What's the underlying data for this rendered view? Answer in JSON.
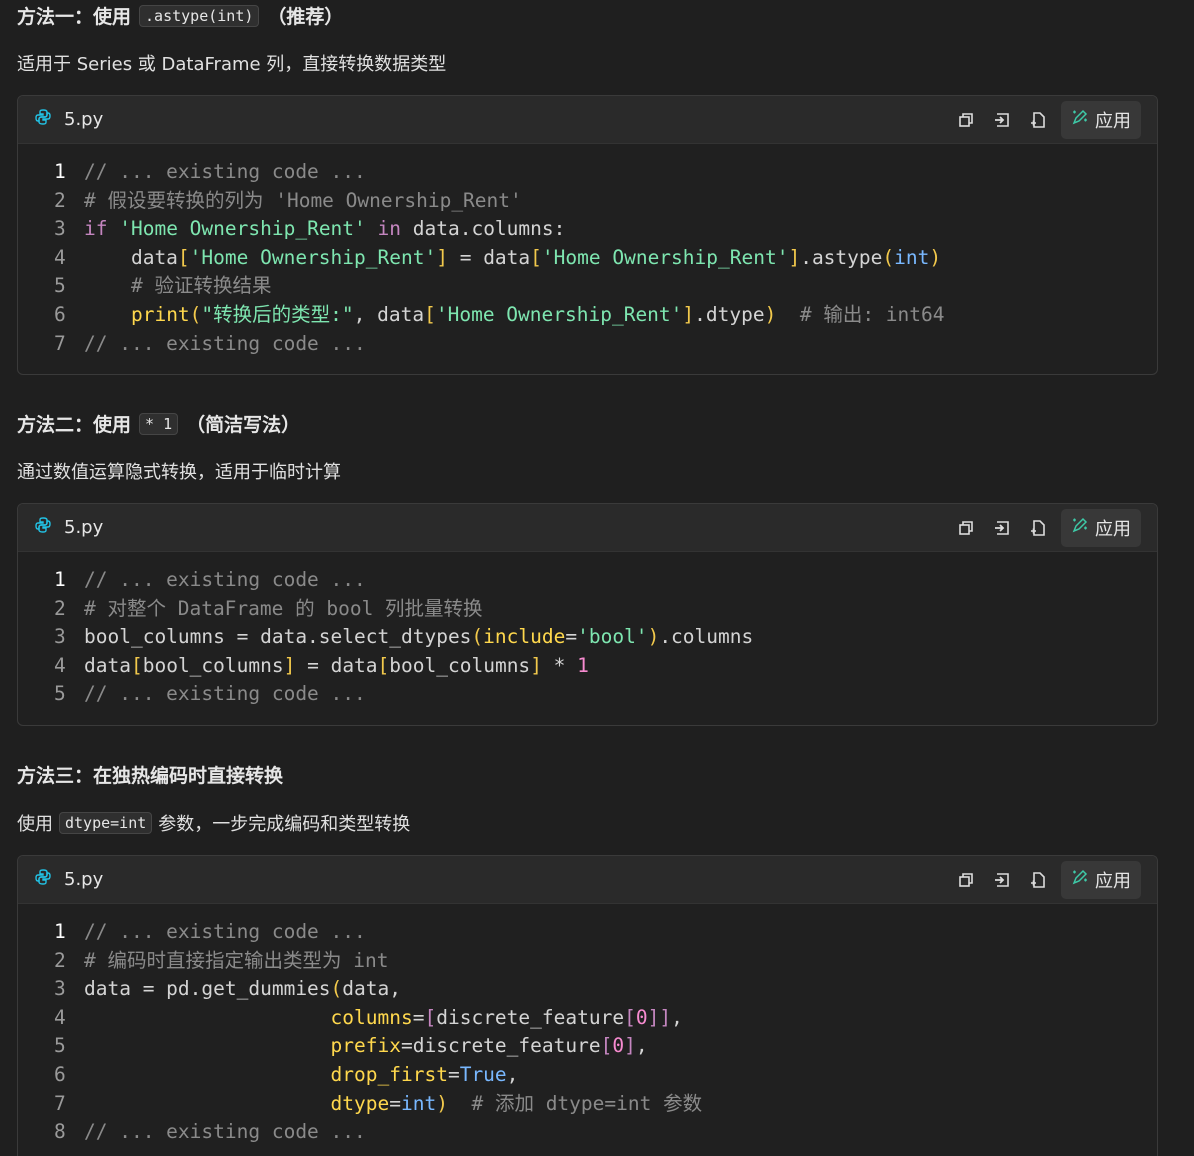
{
  "sections": [
    {
      "title_a": "方法一：使用",
      "title_code": ".astype(int)",
      "title_b": "（推荐）",
      "desc": "适用于 Series 或 DataFrame 列，直接转换数据类型"
    },
    {
      "title_a": "方法二：使用",
      "title_code": "* 1",
      "title_b": "（简洁写法）",
      "desc": "通过数值运算隐式转换，适用于临时计算"
    },
    {
      "title_a": "方法三：在独热编码时直接转换",
      "desc_a": "使用",
      "desc_code": "dtype=int",
      "desc_b": "参数，一步完成编码和类型转换"
    }
  ],
  "blocks": [
    {
      "filename": "5.py",
      "apply_label": "应用",
      "lines": [
        {
          "n": "1",
          "parts": [
            "// ... existing code ..."
          ]
        },
        {
          "n": "2",
          "parts": [
            "# 假设要转换的列为 'Home Ownership_Rent'"
          ]
        },
        {
          "n": "3",
          "parts": [
            "if",
            " ",
            "'Home Ownership_Rent'",
            " ",
            "in",
            " data.columns:"
          ]
        },
        {
          "n": "4",
          "parts": [
            "    data",
            "[",
            "'Home Ownership_Rent'",
            "]",
            " = data",
            "[",
            "'Home Ownership_Rent'",
            "]",
            ".astype",
            "(",
            "int",
            ")"
          ]
        },
        {
          "n": "5",
          "parts": [
            "    # 验证转换结果"
          ]
        },
        {
          "n": "6",
          "parts": [
            "    ",
            "print",
            "(",
            "\"转换后的类型:\"",
            ", data",
            "[",
            "'Home Ownership_Rent'",
            "]",
            ".dtype",
            ")",
            "  ",
            "# 输出: int64"
          ]
        },
        {
          "n": "7",
          "parts": [
            "// ... existing code ..."
          ]
        }
      ]
    },
    {
      "filename": "5.py",
      "apply_label": "应用",
      "lines": [
        {
          "n": "1",
          "parts": [
            "// ... existing code ..."
          ]
        },
        {
          "n": "2",
          "parts": [
            "# 对整个 DataFrame 的 bool 列批量转换"
          ]
        },
        {
          "n": "3",
          "parts": [
            "bool_columns = data.select_dtypes",
            "(",
            "include",
            "=",
            "'bool'",
            ")",
            ".columns"
          ]
        },
        {
          "n": "4",
          "parts": [
            "data",
            "[",
            "bool_columns",
            "]",
            " = data",
            "[",
            "bool_columns",
            "]",
            " * ",
            "1"
          ]
        },
        {
          "n": "5",
          "parts": [
            "// ... existing code ..."
          ]
        }
      ]
    },
    {
      "filename": "5.py",
      "apply_label": "应用",
      "lines": [
        {
          "n": "1",
          "parts": [
            "// ... existing code ..."
          ]
        },
        {
          "n": "2",
          "parts": [
            "# 编码时直接指定输出类型为 int"
          ]
        },
        {
          "n": "3",
          "parts": [
            "data = pd.get_dummies",
            "(",
            "data,"
          ]
        },
        {
          "n": "4",
          "parts": [
            "                     ",
            "columns",
            "=",
            "[",
            "discrete_feature",
            "[",
            "0",
            "]",
            "]",
            ","
          ]
        },
        {
          "n": "5",
          "parts": [
            "                     ",
            "prefix",
            "=discrete_feature",
            "[",
            "0",
            "]",
            ","
          ]
        },
        {
          "n": "6",
          "parts": [
            "                     ",
            "drop_first",
            "=",
            "True",
            ","
          ]
        },
        {
          "n": "7",
          "parts": [
            "                     ",
            "dtype",
            "=",
            "int",
            ")",
            "  ",
            "# 添加 dtype=int 参数"
          ]
        },
        {
          "n": "8",
          "parts": [
            "// ... existing code ..."
          ]
        }
      ]
    }
  ]
}
